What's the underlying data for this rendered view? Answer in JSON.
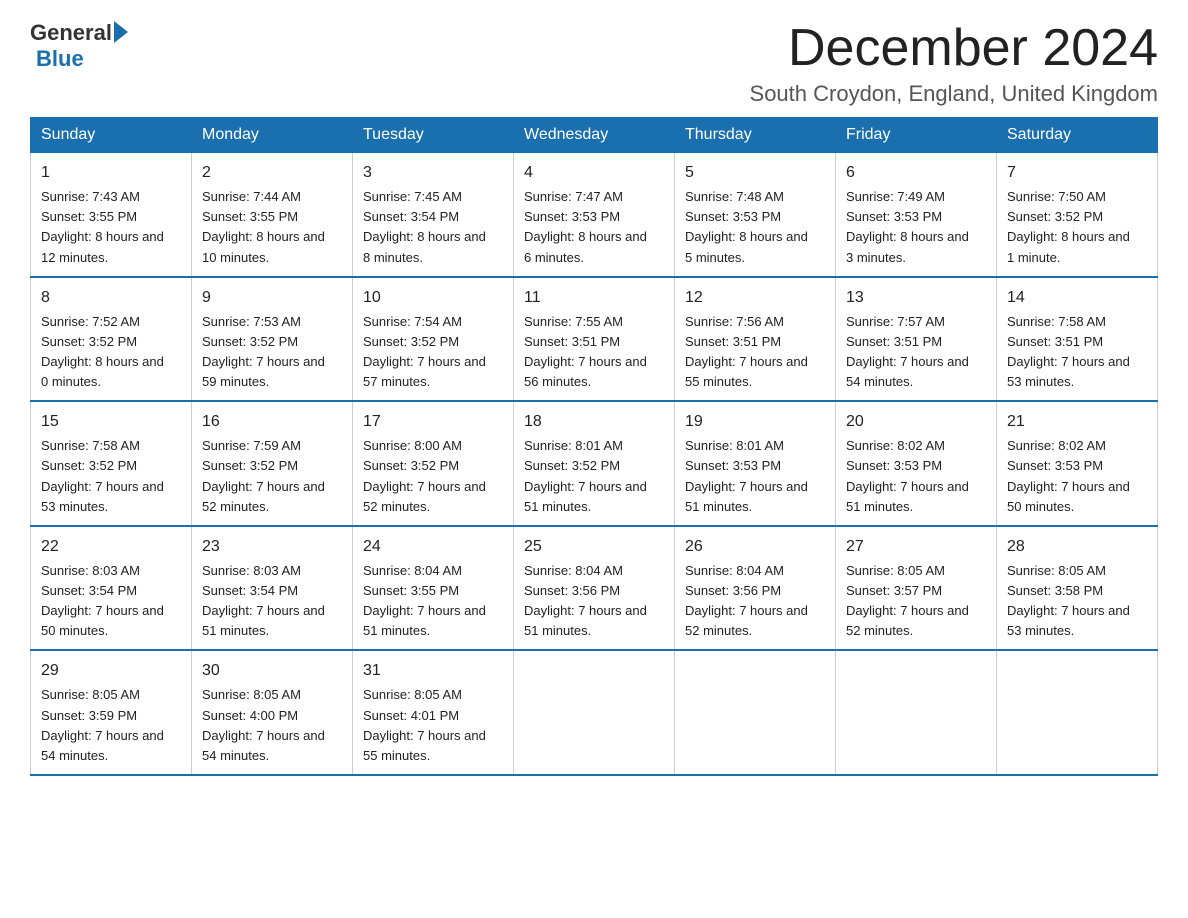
{
  "header": {
    "logo_general": "General",
    "logo_blue": "Blue",
    "title": "December 2024",
    "subtitle": "South Croydon, England, United Kingdom"
  },
  "days_of_week": [
    "Sunday",
    "Monday",
    "Tuesday",
    "Wednesday",
    "Thursday",
    "Friday",
    "Saturday"
  ],
  "weeks": [
    [
      {
        "day": "1",
        "sunrise": "7:43 AM",
        "sunset": "3:55 PM",
        "daylight": "8 hours and 12 minutes."
      },
      {
        "day": "2",
        "sunrise": "7:44 AM",
        "sunset": "3:55 PM",
        "daylight": "8 hours and 10 minutes."
      },
      {
        "day": "3",
        "sunrise": "7:45 AM",
        "sunset": "3:54 PM",
        "daylight": "8 hours and 8 minutes."
      },
      {
        "day": "4",
        "sunrise": "7:47 AM",
        "sunset": "3:53 PM",
        "daylight": "8 hours and 6 minutes."
      },
      {
        "day": "5",
        "sunrise": "7:48 AM",
        "sunset": "3:53 PM",
        "daylight": "8 hours and 5 minutes."
      },
      {
        "day": "6",
        "sunrise": "7:49 AM",
        "sunset": "3:53 PM",
        "daylight": "8 hours and 3 minutes."
      },
      {
        "day": "7",
        "sunrise": "7:50 AM",
        "sunset": "3:52 PM",
        "daylight": "8 hours and 1 minute."
      }
    ],
    [
      {
        "day": "8",
        "sunrise": "7:52 AM",
        "sunset": "3:52 PM",
        "daylight": "8 hours and 0 minutes."
      },
      {
        "day": "9",
        "sunrise": "7:53 AM",
        "sunset": "3:52 PM",
        "daylight": "7 hours and 59 minutes."
      },
      {
        "day": "10",
        "sunrise": "7:54 AM",
        "sunset": "3:52 PM",
        "daylight": "7 hours and 57 minutes."
      },
      {
        "day": "11",
        "sunrise": "7:55 AM",
        "sunset": "3:51 PM",
        "daylight": "7 hours and 56 minutes."
      },
      {
        "day": "12",
        "sunrise": "7:56 AM",
        "sunset": "3:51 PM",
        "daylight": "7 hours and 55 minutes."
      },
      {
        "day": "13",
        "sunrise": "7:57 AM",
        "sunset": "3:51 PM",
        "daylight": "7 hours and 54 minutes."
      },
      {
        "day": "14",
        "sunrise": "7:58 AM",
        "sunset": "3:51 PM",
        "daylight": "7 hours and 53 minutes."
      }
    ],
    [
      {
        "day": "15",
        "sunrise": "7:58 AM",
        "sunset": "3:52 PM",
        "daylight": "7 hours and 53 minutes."
      },
      {
        "day": "16",
        "sunrise": "7:59 AM",
        "sunset": "3:52 PM",
        "daylight": "7 hours and 52 minutes."
      },
      {
        "day": "17",
        "sunrise": "8:00 AM",
        "sunset": "3:52 PM",
        "daylight": "7 hours and 52 minutes."
      },
      {
        "day": "18",
        "sunrise": "8:01 AM",
        "sunset": "3:52 PM",
        "daylight": "7 hours and 51 minutes."
      },
      {
        "day": "19",
        "sunrise": "8:01 AM",
        "sunset": "3:53 PM",
        "daylight": "7 hours and 51 minutes."
      },
      {
        "day": "20",
        "sunrise": "8:02 AM",
        "sunset": "3:53 PM",
        "daylight": "7 hours and 51 minutes."
      },
      {
        "day": "21",
        "sunrise": "8:02 AM",
        "sunset": "3:53 PM",
        "daylight": "7 hours and 50 minutes."
      }
    ],
    [
      {
        "day": "22",
        "sunrise": "8:03 AM",
        "sunset": "3:54 PM",
        "daylight": "7 hours and 50 minutes."
      },
      {
        "day": "23",
        "sunrise": "8:03 AM",
        "sunset": "3:54 PM",
        "daylight": "7 hours and 51 minutes."
      },
      {
        "day": "24",
        "sunrise": "8:04 AM",
        "sunset": "3:55 PM",
        "daylight": "7 hours and 51 minutes."
      },
      {
        "day": "25",
        "sunrise": "8:04 AM",
        "sunset": "3:56 PM",
        "daylight": "7 hours and 51 minutes."
      },
      {
        "day": "26",
        "sunrise": "8:04 AM",
        "sunset": "3:56 PM",
        "daylight": "7 hours and 52 minutes."
      },
      {
        "day": "27",
        "sunrise": "8:05 AM",
        "sunset": "3:57 PM",
        "daylight": "7 hours and 52 minutes."
      },
      {
        "day": "28",
        "sunrise": "8:05 AM",
        "sunset": "3:58 PM",
        "daylight": "7 hours and 53 minutes."
      }
    ],
    [
      {
        "day": "29",
        "sunrise": "8:05 AM",
        "sunset": "3:59 PM",
        "daylight": "7 hours and 54 minutes."
      },
      {
        "day": "30",
        "sunrise": "8:05 AM",
        "sunset": "4:00 PM",
        "daylight": "7 hours and 54 minutes."
      },
      {
        "day": "31",
        "sunrise": "8:05 AM",
        "sunset": "4:01 PM",
        "daylight": "7 hours and 55 minutes."
      },
      null,
      null,
      null,
      null
    ]
  ],
  "labels": {
    "sunrise": "Sunrise:",
    "sunset": "Sunset:",
    "daylight": "Daylight:"
  }
}
